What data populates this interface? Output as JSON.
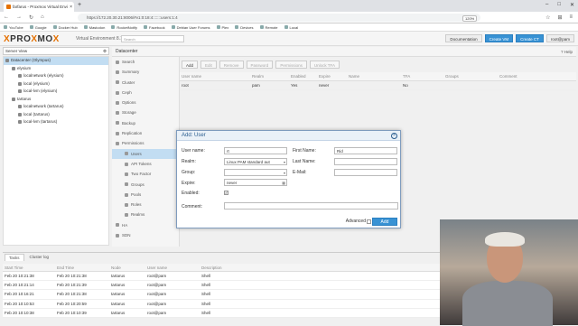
{
  "browser": {
    "tab_title": "farfarus - Proxmox Virtual Envir...",
    "url": "https://172.20.30.21:8006/#v1:0:18:4:::::::users:1:4",
    "zoom": "120%",
    "bookmarks": [
      "YouTube",
      "Google",
      "Docker Hub",
      "Mastodon",
      "RocketNotify",
      "Facebook",
      "Debian User Forums",
      "Plex",
      "Devices",
      "Remote",
      "Local"
    ]
  },
  "pve": {
    "logo_prefix": "PRO",
    "logo_x": "X",
    "logo_suffix": "MO",
    "logo_x2": "X",
    "version": "Virtual Environment 8.1.4",
    "search_placeholder": "Search",
    "header_buttons": [
      "Documentation",
      "Create VM",
      "Create CT",
      "root@pam"
    ]
  },
  "sidebar": {
    "view": "Server View",
    "tree": [
      {
        "label": "Datacenter (Olympus)",
        "level": 0,
        "selected": true
      },
      {
        "label": "elysium",
        "level": 1,
        "selected": false
      },
      {
        "label": "localnetwork (elysium)",
        "level": 2,
        "selected": false
      },
      {
        "label": "local (elysium)",
        "level": 2,
        "selected": false
      },
      {
        "label": "local-lvm (elysium)",
        "level": 2,
        "selected": false
      },
      {
        "label": "tartarus",
        "level": 1,
        "selected": false
      },
      {
        "label": "localnetwork (tartarus)",
        "level": 2,
        "selected": false
      },
      {
        "label": "local (tartarus)",
        "level": 2,
        "selected": false
      },
      {
        "label": "local-lvm (tartarus)",
        "level": 2,
        "selected": false
      }
    ]
  },
  "content": {
    "breadcrumb": "Datacenter",
    "help": "Help",
    "menu": [
      {
        "label": "Search",
        "sub": false,
        "selected": false
      },
      {
        "label": "Summary",
        "sub": false,
        "selected": false
      },
      {
        "label": "Cluster",
        "sub": false,
        "selected": false
      },
      {
        "label": "Ceph",
        "sub": false,
        "selected": false
      },
      {
        "label": "Options",
        "sub": false,
        "selected": false
      },
      {
        "label": "Storage",
        "sub": false,
        "selected": false
      },
      {
        "label": "Backup",
        "sub": false,
        "selected": false
      },
      {
        "label": "Replication",
        "sub": false,
        "selected": false
      },
      {
        "label": "Permissions",
        "sub": false,
        "selected": false
      },
      {
        "label": "Users",
        "sub": true,
        "selected": true
      },
      {
        "label": "API Tokens",
        "sub": true,
        "selected": false
      },
      {
        "label": "Two Factor",
        "sub": true,
        "selected": false
      },
      {
        "label": "Groups",
        "sub": true,
        "selected": false
      },
      {
        "label": "Pools",
        "sub": true,
        "selected": false
      },
      {
        "label": "Roles",
        "sub": true,
        "selected": false
      },
      {
        "label": "Realms",
        "sub": true,
        "selected": false
      },
      {
        "label": "HA",
        "sub": false,
        "selected": false
      },
      {
        "label": "SDN",
        "sub": false,
        "selected": false
      }
    ],
    "toolbar": [
      "Add",
      "Edit",
      "Remove",
      "Password",
      "Permissions",
      "Unlock TFA"
    ],
    "columns": [
      "User name",
      "Realm",
      "Enabled",
      "Expire",
      "Name",
      "TFA",
      "Groups",
      "Comment"
    ],
    "rows": [
      [
        "root",
        "pam",
        "Yes",
        "never",
        "",
        "No",
        "",
        ""
      ]
    ]
  },
  "dialog": {
    "title": "Add: User",
    "username_label": "User name:",
    "username_value": "rt",
    "realm_label": "Realm:",
    "realm_value": "Linux PAM standard aut",
    "group_label": "Group:",
    "group_value": "",
    "expire_label": "Expire:",
    "expire_value": "never",
    "enabled_label": "Enabled:",
    "enabled_checked": true,
    "comment_label": "Comment:",
    "comment_value": "",
    "firstname_label": "First Name:",
    "firstname_value": "Rid",
    "lastname_label": "Last Name:",
    "lastname_value": "",
    "email_label": "E-Mail:",
    "email_value": "",
    "advanced_label": "Advanced",
    "add_label": "Add"
  },
  "log": {
    "tabs": [
      "Tasks",
      "Cluster log"
    ],
    "columns": [
      "Start Time",
      "End Time",
      "Node",
      "User name",
      "Description"
    ],
    "rows": [
      [
        "Feb 20 10:21:38",
        "Feb 20 10:21:38",
        "tartarus",
        "root@pam",
        "Shell"
      ],
      [
        "Feb 20 10:21:14",
        "Feb 20 10:21:39",
        "tartarus",
        "root@pam",
        "Shell"
      ],
      [
        "Feb 20 10:16:21",
        "Feb 20 10:21:38",
        "tartarus",
        "root@pam",
        "Shell"
      ],
      [
        "Feb 20 10:10:53",
        "Feb 20 10:20:59",
        "tartarus",
        "root@pam",
        "Shell"
      ],
      [
        "Feb 20 10:10:38",
        "Feb 20 10:10:39",
        "tartarus",
        "root@pam",
        "Shell"
      ]
    ]
  }
}
